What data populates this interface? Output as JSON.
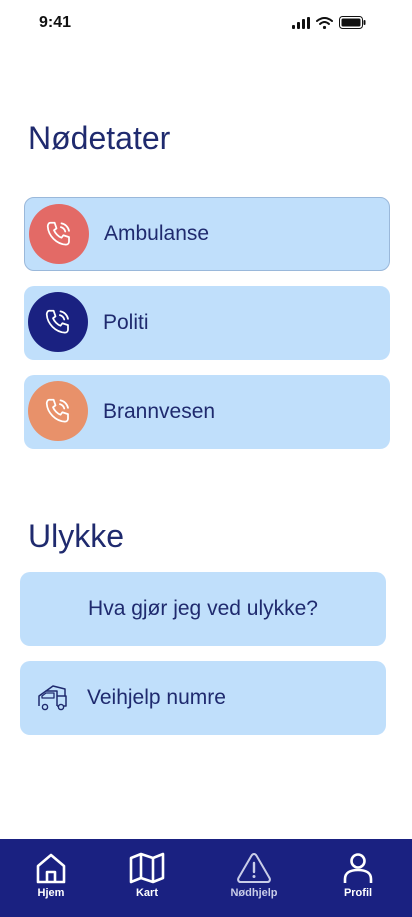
{
  "status": {
    "time": "9:41"
  },
  "emergency": {
    "title": "Nødetater",
    "services": [
      {
        "label": "Ambulanse",
        "color": "#e36a66",
        "icon": "phone-icon"
      },
      {
        "label": "Politi",
        "color": "#1a2181",
        "icon": "phone-icon"
      },
      {
        "label": "Brannvesen",
        "color": "#e8916a",
        "icon": "phone-icon"
      }
    ]
  },
  "accident": {
    "title": "Ulykke",
    "items": [
      {
        "label": "Hva gjør jeg ved ulykke?"
      },
      {
        "label": "Veihjelp numre",
        "icon": "tow-truck-icon"
      }
    ]
  },
  "nav": {
    "items": [
      {
        "label": "Hjem",
        "icon": "home-icon"
      },
      {
        "label": "Kart",
        "icon": "map-icon"
      },
      {
        "label": "Nødhjelp",
        "icon": "alert-icon"
      },
      {
        "label": "Profil",
        "icon": "user-icon"
      }
    ]
  },
  "colors": {
    "primary": "#1a2181",
    "card": "#c0dffb",
    "text": "#1f2a6e"
  }
}
